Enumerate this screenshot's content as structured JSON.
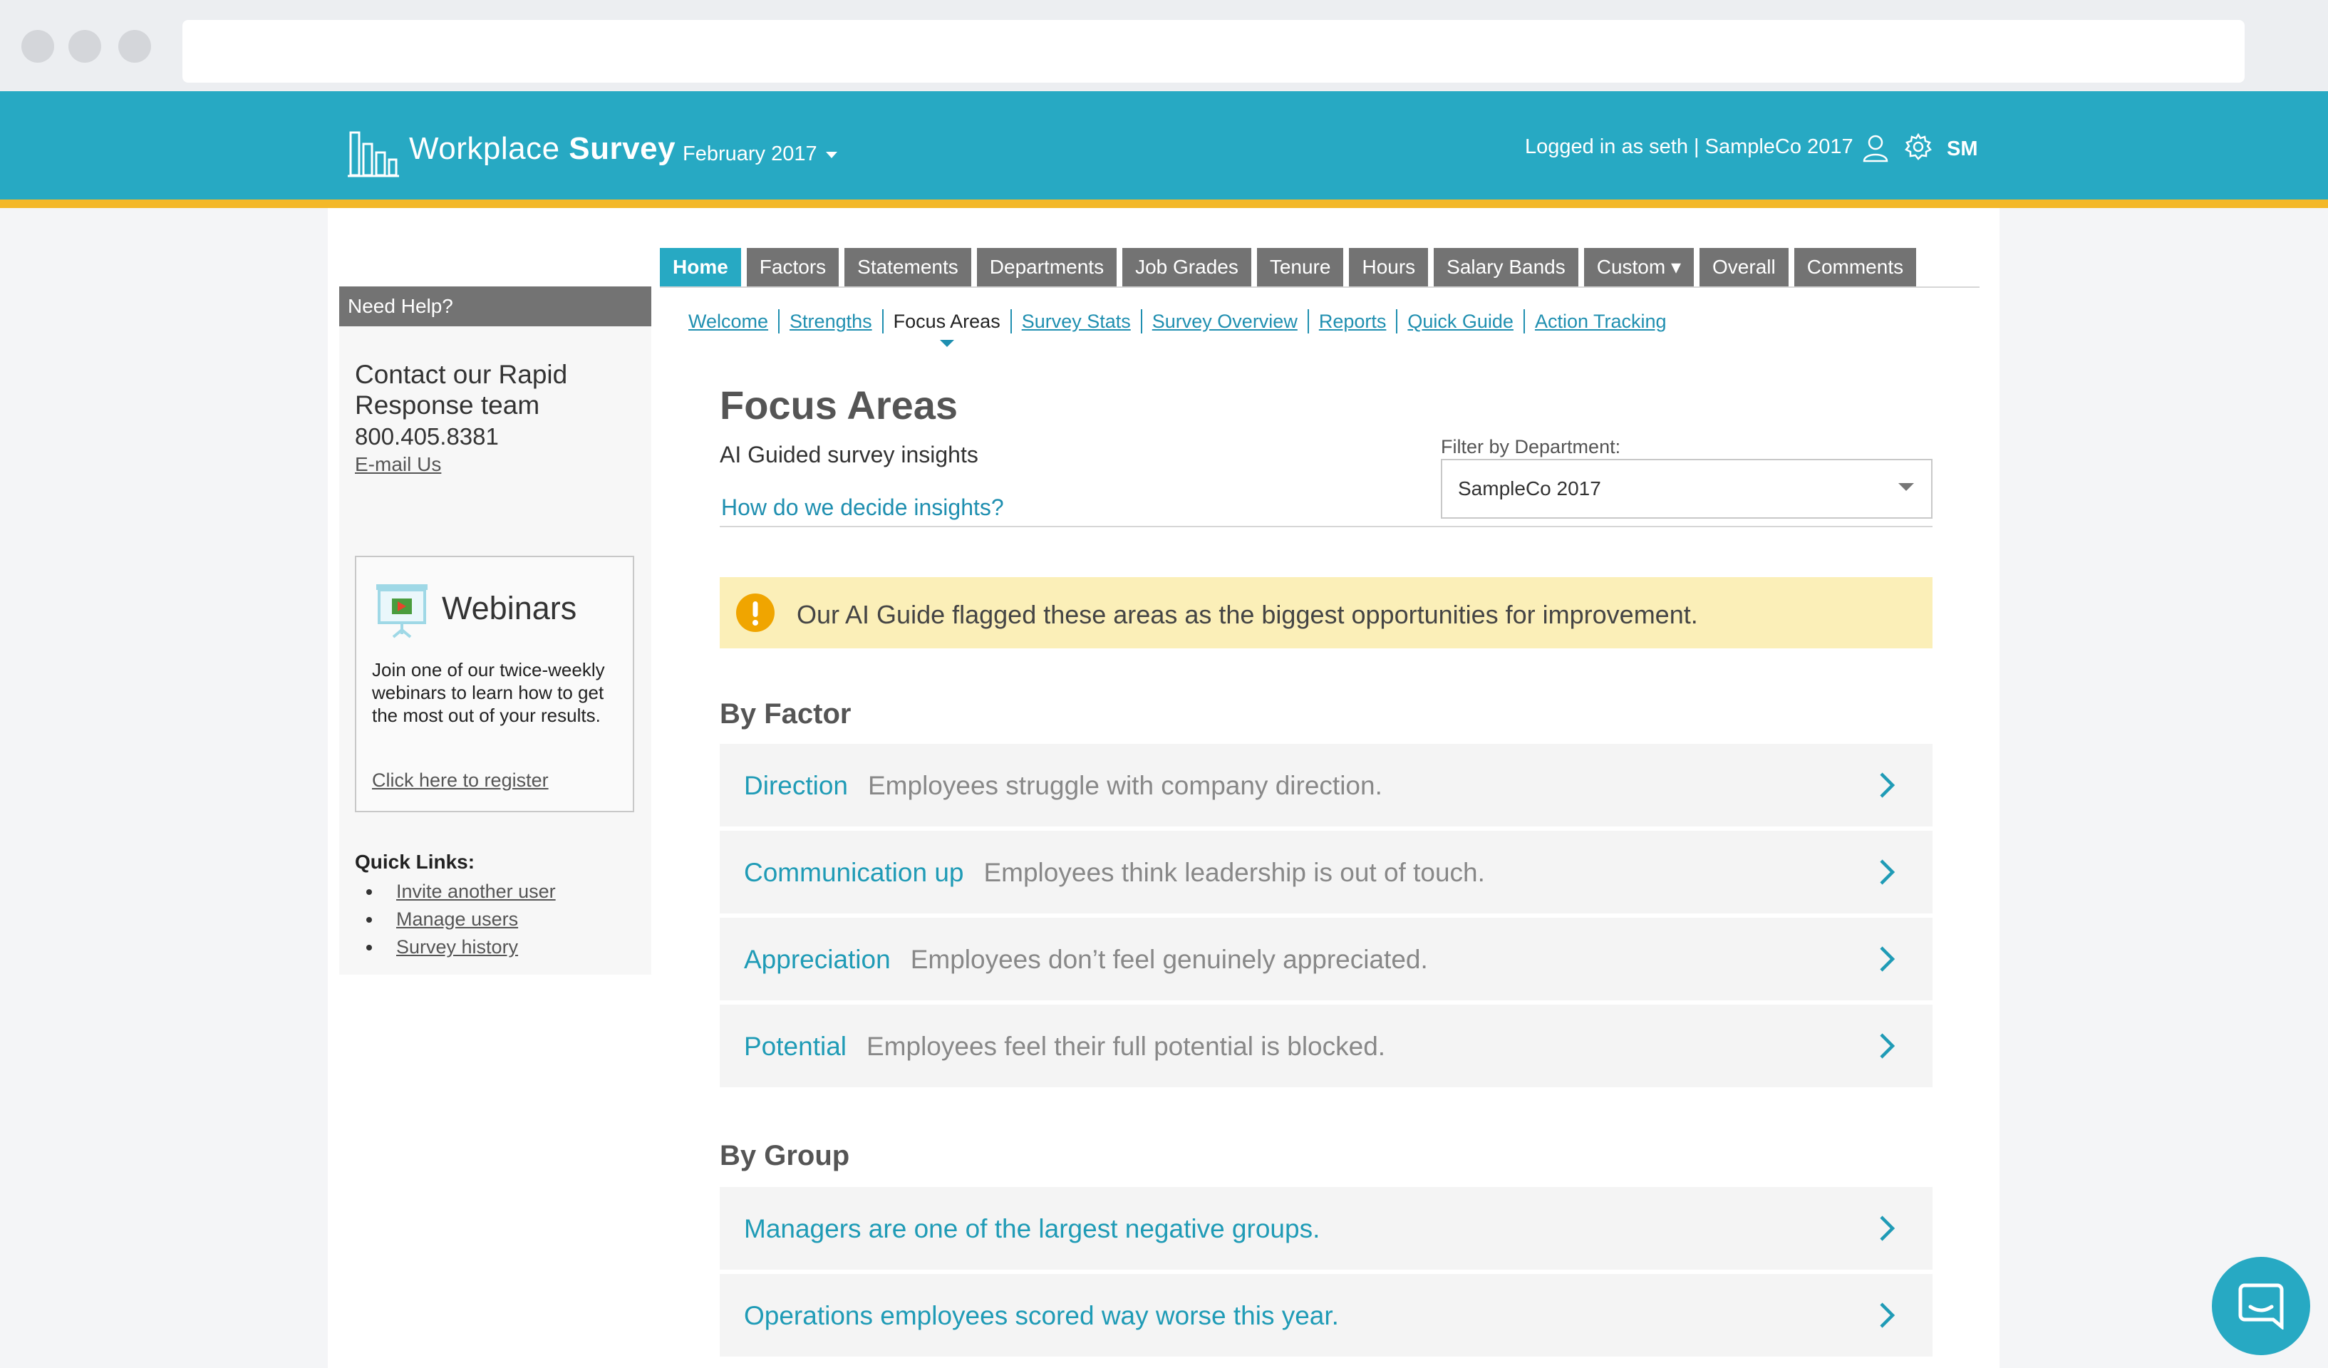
{
  "header": {
    "brand_light": "Workplace ",
    "brand_bold": "Survey",
    "period": "February 2017",
    "login_status": "Logged in as seth | SampleCo 2017",
    "user_initials": "SM"
  },
  "tabs": [
    {
      "label": "Home",
      "active": true
    },
    {
      "label": "Factors"
    },
    {
      "label": "Statements"
    },
    {
      "label": "Departments"
    },
    {
      "label": "Job Grades"
    },
    {
      "label": "Tenure"
    },
    {
      "label": "Hours"
    },
    {
      "label": "Salary Bands"
    },
    {
      "label": "Custom ▾"
    },
    {
      "label": "Overall"
    },
    {
      "label": "Comments"
    }
  ],
  "subnav": [
    {
      "label": "Welcome"
    },
    {
      "label": "Strengths"
    },
    {
      "label": "Focus Areas",
      "active": true
    },
    {
      "label": "Survey Stats"
    },
    {
      "label": "Survey Overview"
    },
    {
      "label": "Reports"
    },
    {
      "label": "Quick Guide"
    },
    {
      "label": "Action Tracking"
    }
  ],
  "sidebar": {
    "help_title": "Need Help?",
    "contact_title": "Contact our Rapid Response team",
    "phone": "800.405.8381",
    "email_link": "E-mail Us",
    "webinar": {
      "title": "Webinars",
      "description": "Join one of our twice-weekly webinars to learn how to get the most out of your results.",
      "link": "Click here to register"
    },
    "quick_links_title": "Quick Links:",
    "quick_links": [
      "Invite another user",
      "Manage users",
      "Survey history"
    ]
  },
  "main": {
    "title": "Focus Areas",
    "subtitle": "AI Guided survey insights",
    "insights_link": "How do we decide insights?",
    "filter": {
      "label": "Filter by Department:",
      "value": "SampleCo 2017"
    },
    "alert": "Our AI Guide flagged these areas as the biggest opportunities for improvement.",
    "by_factor_title": "By Factor",
    "factors": [
      {
        "name": "Direction",
        "desc": "Employees struggle with company direction."
      },
      {
        "name": "Communication up",
        "desc": "Employees think leadership is out of touch."
      },
      {
        "name": "Appreciation",
        "desc": "Employees don’t feel genuinely appreciated."
      },
      {
        "name": "Potential",
        "desc": "Employees feel their full potential is blocked."
      }
    ],
    "by_group_title": "By Group",
    "groups": [
      "Managers are one of the largest negative groups.",
      "Operations employees scored way worse this year."
    ]
  },
  "colors": {
    "brand": "#27a9c3",
    "accent": "#f3b829",
    "tab_inactive": "#737373",
    "link": "#1f8fb0",
    "alert_bg": "#fbefb8"
  },
  "icons": {
    "logo": "bar-chart-logo-icon",
    "user": "user-icon",
    "settings": "gear-icon",
    "webinar": "presentation-screen-icon",
    "alert": "exclamation-icon",
    "row": "chevron-right-icon",
    "chat": "chat-bubble-icon"
  }
}
